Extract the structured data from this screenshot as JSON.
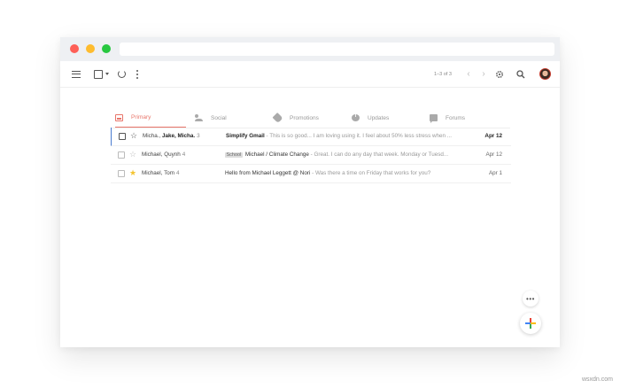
{
  "toolbar": {
    "pagination": "1–3 of 3",
    "prev_icon": "‹",
    "next_icon": "›",
    "settings_icon": "⚙",
    "search_icon": "⚲"
  },
  "tabs": [
    {
      "label": "Primary",
      "icon": "inbox-icon"
    },
    {
      "label": "Social",
      "icon": "people-icon"
    },
    {
      "label": "Promotions",
      "icon": "tag-icon"
    },
    {
      "label": "Updates",
      "icon": "info-icon"
    },
    {
      "label": "Forums",
      "icon": "forum-icon"
    }
  ],
  "emails": [
    {
      "sender_a": "Micha.,",
      "sender_b": "Jake, Micha.",
      "count": "3",
      "label": "",
      "subject": "Simplify Gmail",
      "snippet": " - This is so good... I am loving using it. I feel about 50% less stress when ...",
      "date": "Apr 12"
    },
    {
      "sender_a": "Michael, Quynh",
      "count": "4",
      "label": "School",
      "subject": "Michael / Climate Change",
      "snippet": " - Great. I can do any day that week. Monday or Tuesd...",
      "date": "Apr 12"
    },
    {
      "sender_a": "Michael, Tom",
      "count": "4",
      "label": "",
      "subject": "Hello from Michael Leggett @ Nori",
      "snippet": " - Was there a time on Friday that works for you?",
      "date": "Apr 1"
    }
  ],
  "fab": {
    "more": "•••"
  },
  "watermark": "wsxdn.com",
  "colors": {
    "accent": "#e8756a",
    "selected_bar": "#4a7bd0",
    "star": "#f4c430"
  }
}
